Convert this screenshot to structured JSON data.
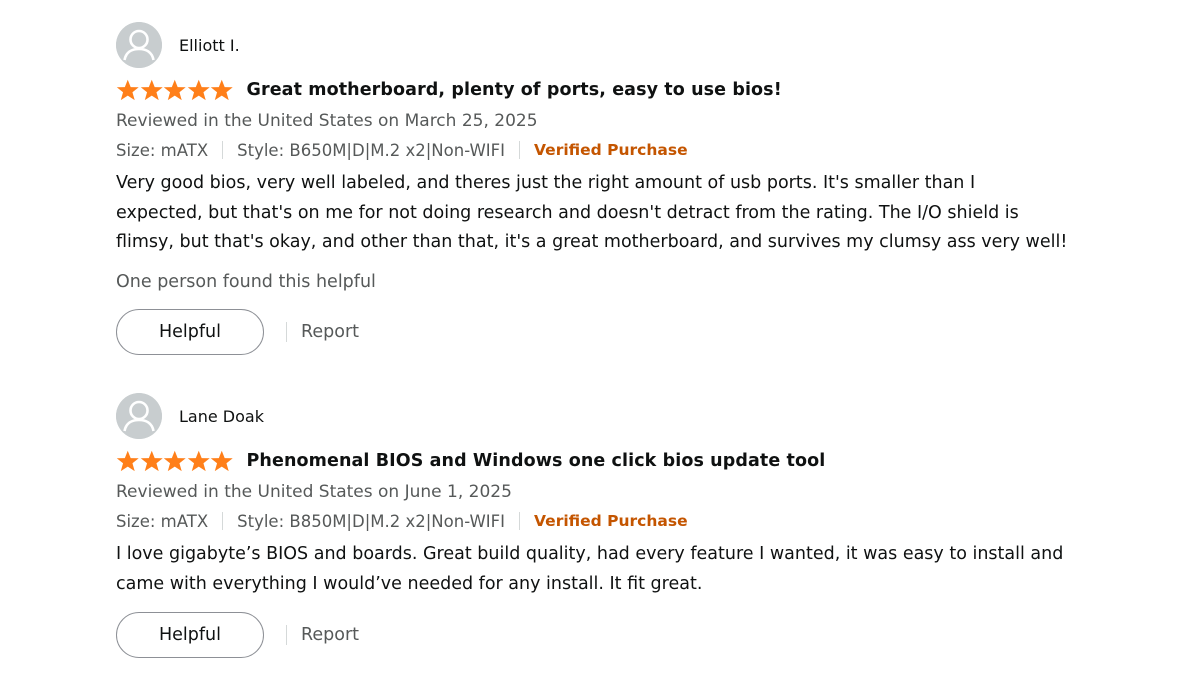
{
  "colors": {
    "star": "#ff7f19",
    "verified": "#c45500",
    "secondary_text": "#565959",
    "primary_text": "#0f1111"
  },
  "reviews": [
    {
      "author": "Elliott I.",
      "rating": 5,
      "title": "Great motherboard, plenty of ports, easy to use bios!",
      "date": "Reviewed in the United States on March 25, 2025",
      "size": "Size: mATX",
      "style": "Style: B650M|D|M.2 x2|Non-WIFI",
      "verified": "Verified Purchase",
      "body_lines": [
        "Very good bios, very well labeled, and theres just the right amount of usb ports. It's smaller than I",
        "expected, but that's on me for not doing research and doesn't detract from the rating. The I/O shield is",
        "flimsy, but that's okay, and other than that, it's a great motherboard, and survives my clumsy ass very well!"
      ],
      "helpful_count": "One person found this helpful",
      "helpful_label": "Helpful",
      "report_label": "Report"
    },
    {
      "author": "Lane Doak",
      "rating": 5,
      "title": "Phenomenal BIOS and Windows one click bios update tool",
      "date": "Reviewed in the United States on June 1, 2025",
      "size": "Size: mATX",
      "style": "Style: B850M|D|M.2 x2|Non-WIFI",
      "verified": "Verified Purchase",
      "body_lines": [
        "I love gigabyte’s BIOS and boards. Great build quality, had every feature I wanted, it was easy to install and",
        "came with everything I would’ve needed for any install. It fit great."
      ],
      "helpful_label": "Helpful",
      "report_label": "Report"
    }
  ]
}
